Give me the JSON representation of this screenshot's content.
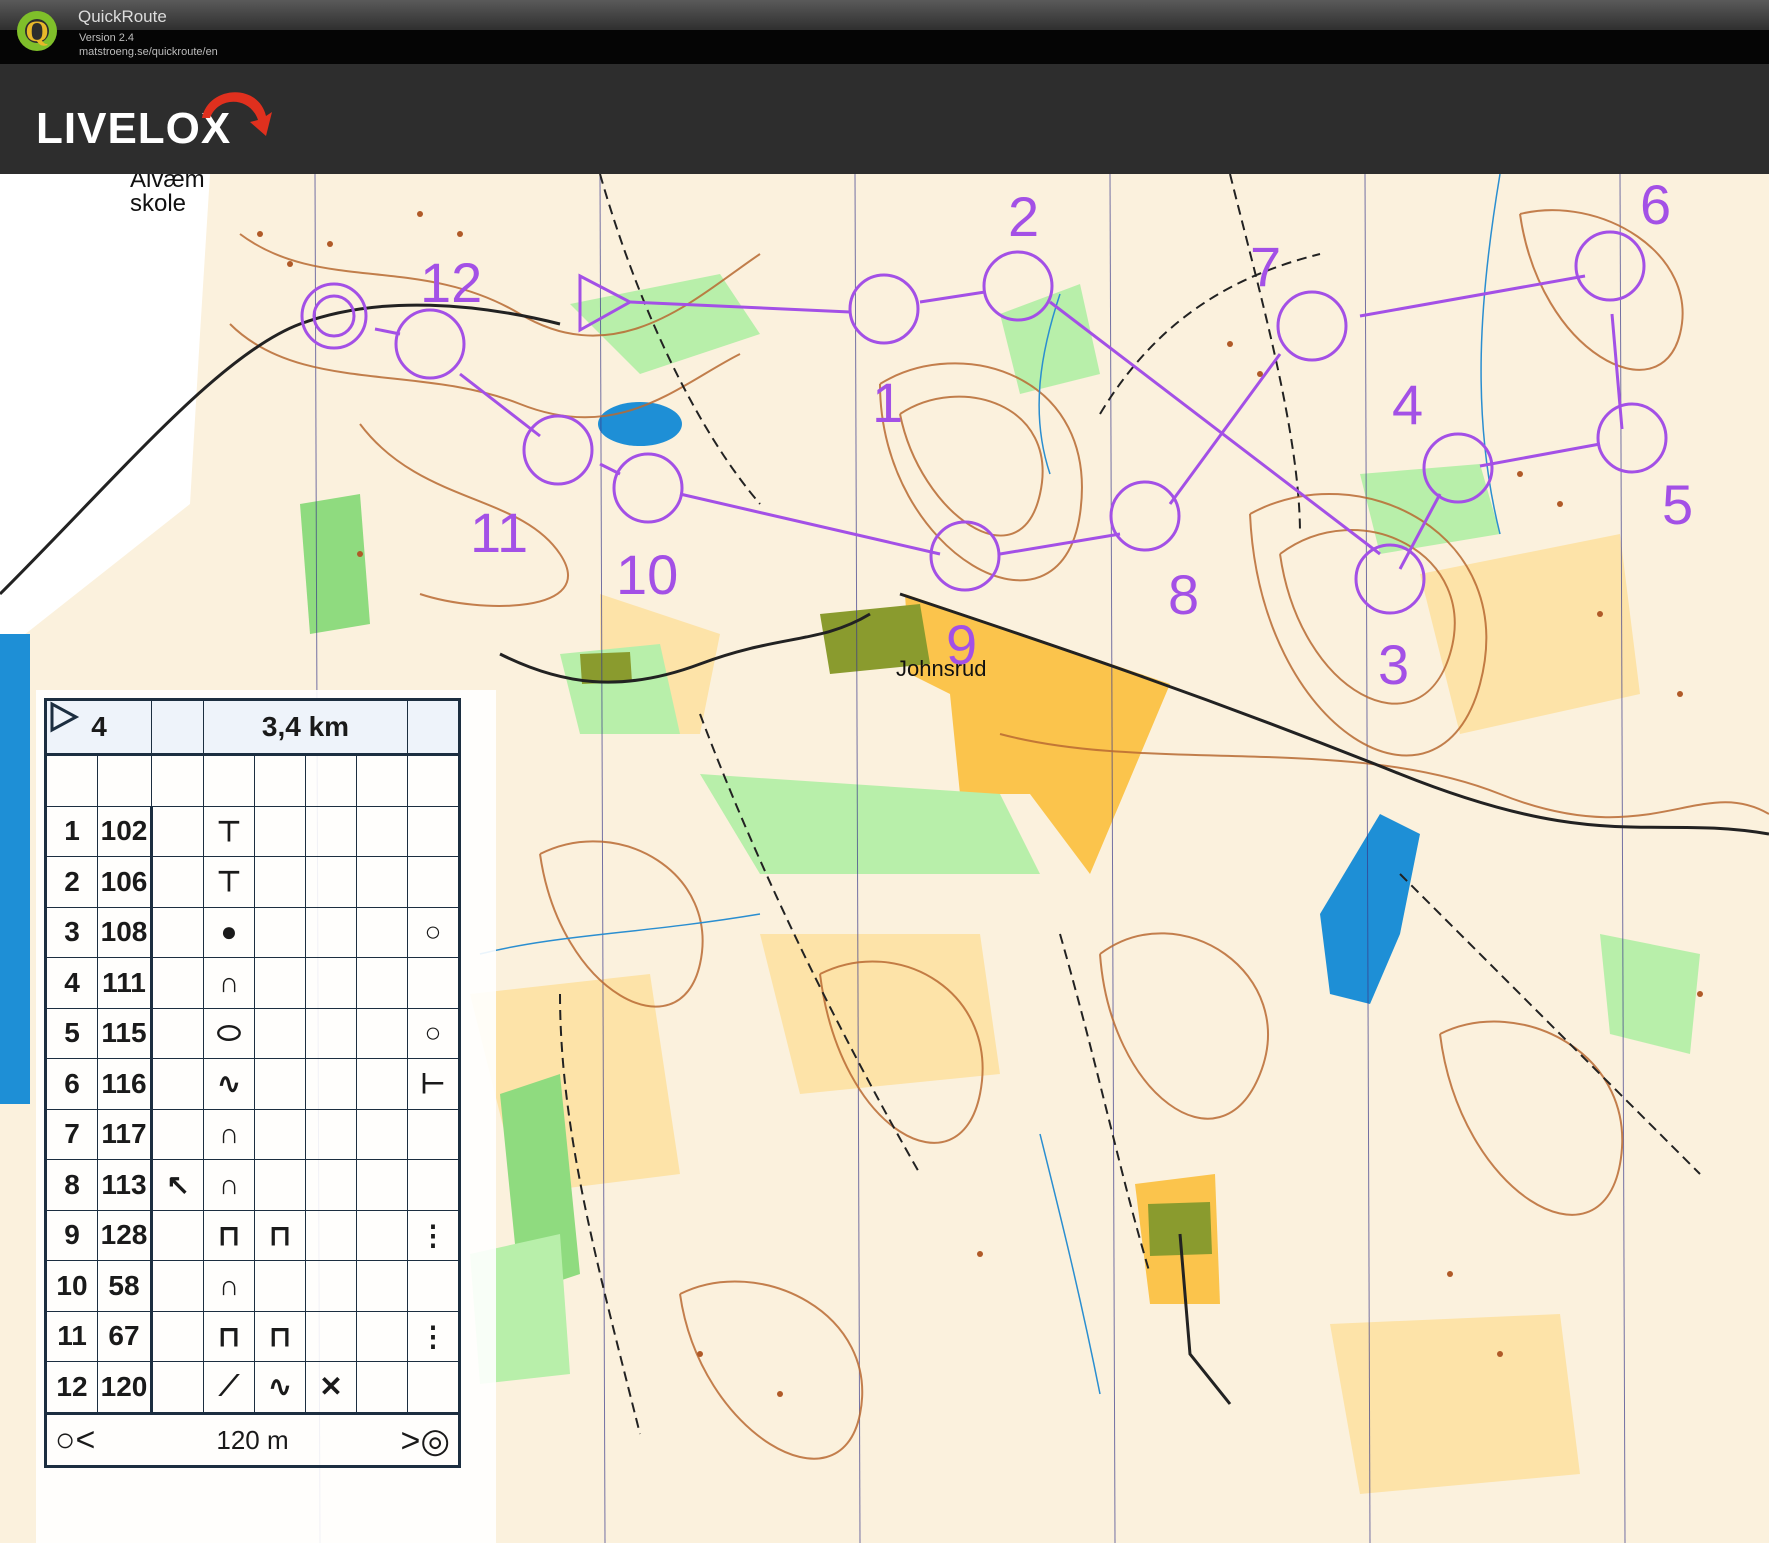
{
  "app": {
    "title": "QuickRoute",
    "version": "Version 2.4",
    "url": "matstroeng.se/quickroute/en",
    "logo_letter": "Q"
  },
  "header": {
    "brand": "LIVELOX"
  },
  "map": {
    "place_names": [
      "Alvæm",
      "skole",
      "Johnsrud"
    ],
    "course_color": "#a350e6",
    "control_numbers": [
      "1",
      "2",
      "3",
      "4",
      "5",
      "6",
      "7",
      "8",
      "9",
      "10",
      "11",
      "12"
    ]
  },
  "description_sheet": {
    "course": "4",
    "length": "3,4 km",
    "rows": [
      {
        "num": "1",
        "code": "102"
      },
      {
        "num": "2",
        "code": "106"
      },
      {
        "num": "3",
        "code": "108"
      },
      {
        "num": "4",
        "code": "111"
      },
      {
        "num": "5",
        "code": "115"
      },
      {
        "num": "6",
        "code": "116"
      },
      {
        "num": "7",
        "code": "117"
      },
      {
        "num": "8",
        "code": "113"
      },
      {
        "num": "9",
        "code": "128"
      },
      {
        "num": "10",
        "code": "58"
      },
      {
        "num": "11",
        "code": "67"
      },
      {
        "num": "12",
        "code": "120"
      }
    ],
    "finish_distance": "120 m"
  }
}
